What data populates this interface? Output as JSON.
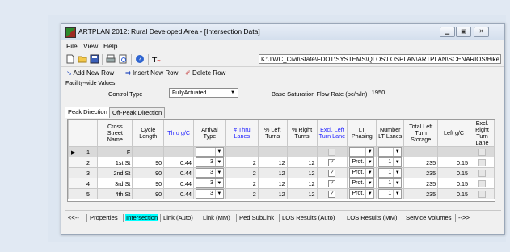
{
  "window": {
    "title": "ARTPLAN 2012: Rural Developed Area - [Intersection Data]"
  },
  "menu": [
    "File",
    "View",
    "Help"
  ],
  "toolbar": {
    "icons": [
      "new-file-icon",
      "open-folder-icon",
      "save-icon",
      "print-icon",
      "print-preview-icon",
      "help-icon",
      "tools-icon"
    ],
    "path": "K:\\TWC_Civil\\State\\FDOT\\SYSTEMS\\QLOS\\LOSPLAN\\ARTPLAN\\SCENARIOS\\Bike ru"
  },
  "rowtools": {
    "add": "Add New Row",
    "insert": "Insert New Row",
    "delete": "Delete Row"
  },
  "facility": {
    "group_label": "Facility-wide Values",
    "control_type_label": "Control Type",
    "control_type_value": "FullyActuated",
    "bsfr_label": "Base Saturation Flow Rate (pc/h/ln)",
    "bsfr_value": "1950"
  },
  "tabs": [
    "Peak Direction",
    "Off-Peak Direction"
  ],
  "grid": {
    "headers": [
      "Cross Street Name",
      "Cycle Length",
      "Thru g/C",
      "Arrival Type",
      "# Thru Lanes",
      "% Left Turns",
      "% Right Turns",
      "Excl. Left Turn Lane",
      "LT Phasing",
      "Number LT Lanes",
      "Total Left Turn Storage",
      "Left g/C",
      "Excl. Right Turn Lane"
    ],
    "blue_headers": [
      2,
      4,
      7
    ],
    "rows": [
      {
        "id": "1",
        "current": true,
        "new": true,
        "cells": [
          "F",
          "",
          "",
          "",
          "",
          "",
          "",
          "",
          "",
          "",
          "",
          "",
          ""
        ]
      },
      {
        "id": "2",
        "cells": [
          "1st St",
          "90",
          "0.44",
          "3",
          "2",
          "12",
          "12",
          "true",
          "Prot.",
          "1",
          "235",
          "0.15",
          "false"
        ]
      },
      {
        "id": "3",
        "cells": [
          "2nd St",
          "90",
          "0.44",
          "3",
          "2",
          "12",
          "12",
          "true",
          "Prot.",
          "1",
          "235",
          "0.15",
          "false"
        ]
      },
      {
        "id": "4",
        "cells": [
          "3rd St",
          "90",
          "0.44",
          "3",
          "2",
          "12",
          "12",
          "true",
          "Prot.",
          "1",
          "235",
          "0.15",
          "false"
        ]
      },
      {
        "id": "5",
        "cells": [
          "4th St",
          "90",
          "0.44",
          "3",
          "2",
          "12",
          "12",
          "true",
          "Prot.",
          "1",
          "235",
          "0.15",
          "false"
        ]
      }
    ]
  },
  "bottom_tabs": [
    "<<--",
    "Properties",
    "Intersection",
    "Link (Auto)",
    "Link (MM)",
    "Ped SubLink",
    "LOS Results (Auto)",
    "LOS Results (MM)",
    "Service Volumes",
    "-->>"
  ],
  "bottom_active": "Intersection",
  "colors": {
    "active_tab": "#00ffff",
    "blue_header": "#1a1aff"
  }
}
